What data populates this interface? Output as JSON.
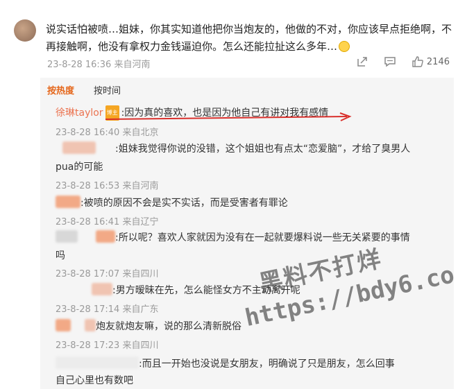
{
  "post": {
    "text": "说实话怕被喷…姐妹，你其实知道他把你当炮友的，他做的不对，你应该早点拒绝啊，不再接触啊，他没有拿权力金钱逼迫你。怎么还能拉扯这么多年…",
    "time": "23-8-28 16:36 来自河南",
    "like_count": "2146",
    "icons": [
      "share-icon",
      "comment-icon",
      "like-icon"
    ]
  },
  "tabs": {
    "hot": "按热度",
    "time": "按时间"
  },
  "comments": [
    {
      "user": "徐琳taylor",
      "badge": "博主",
      "text": ":因为真的喜欢，也是因为他自己有讲对我有感情",
      "meta": "23-8-28 16:40 来自北京"
    },
    {
      "text_1": ":姐妹我觉得你说的没错，这个姐姐也有点太“恋爱脑”，才给了臭男人",
      "text_2": "pua的可能",
      "meta": "23-8-28 16:53 来自河南"
    },
    {
      "text": ":被喷的原因不会是实不实话，而是受害者有罪论",
      "meta": "23-8-28 16:41 来自辽宁"
    },
    {
      "text_1": ":所以呢？喜欢人家就因为没有在一起就要爆料说一些无关紧要的事情",
      "text_2": "吗",
      "meta": "23-8-28 17:07 来自四川"
    },
    {
      "text": ":男方暧昧在先，怎么能怪女方不主动离开呢",
      "meta": "23-8-28 17:14 来自广东"
    },
    {
      "text": "炮友就炮友嘛，说的那么清新脱俗",
      "meta": "23-8-28 17:23 来自四川"
    },
    {
      "text_1": ":而且一开始也没说是女朋友，明确说了只是朋友，怎么回事",
      "text_2": "自己心里也有数吧"
    }
  ],
  "watermark": {
    "line1": "黑料不打烊",
    "line2": "https://bdy6.co"
  }
}
